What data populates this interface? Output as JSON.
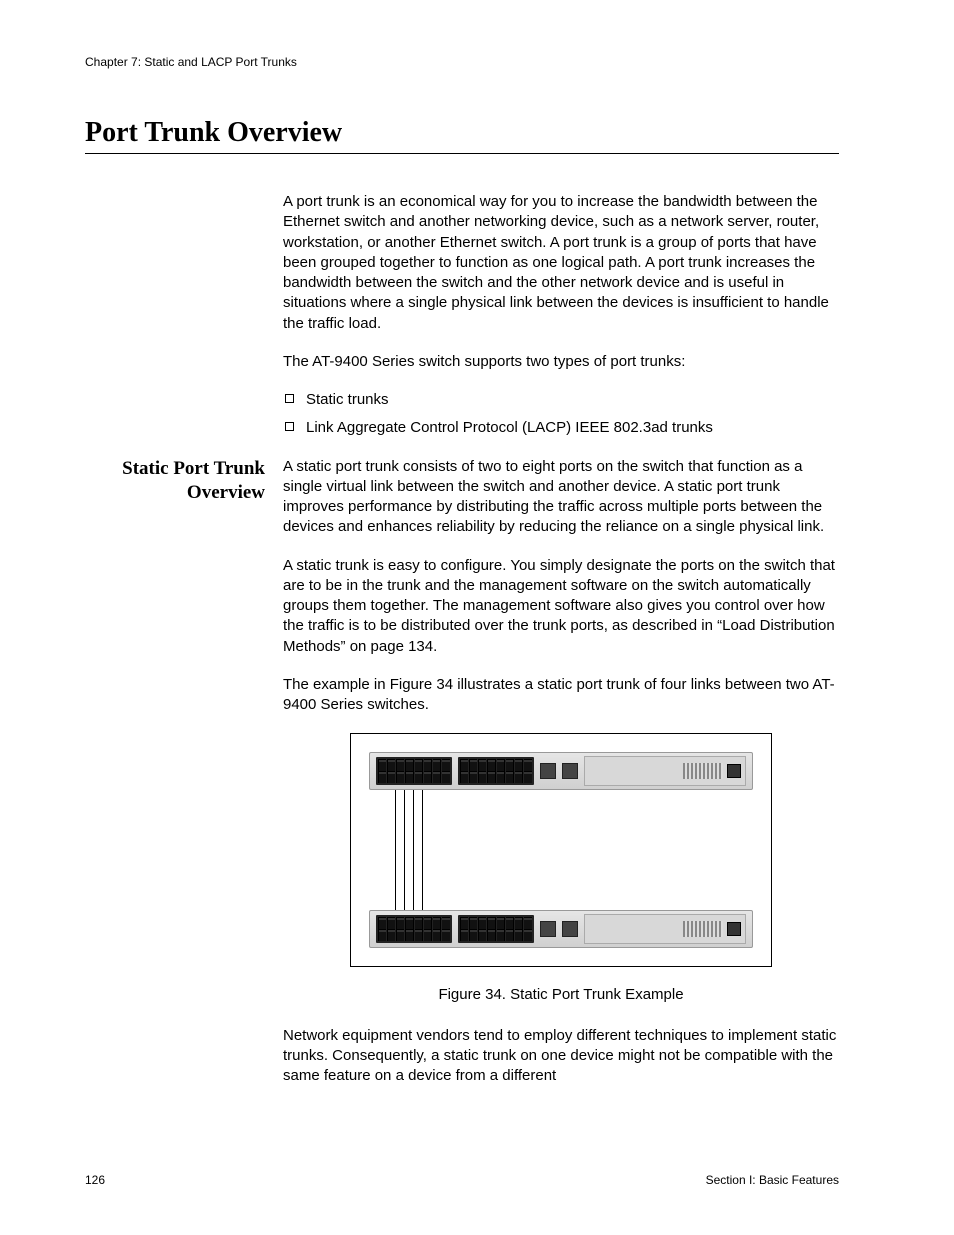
{
  "header": {
    "chapter": "Chapter 7: Static and LACP Port Trunks"
  },
  "heading": "Port Trunk Overview",
  "intro": {
    "p1": "A port trunk is an economical way for you to increase the bandwidth between the Ethernet switch and another networking device, such as a network server, router, workstation, or another Ethernet switch. A port trunk is a group of ports that have been grouped together to function as one logical path. A port trunk increases the bandwidth between the switch and the other network device and is useful in situations where a single physical link between the devices is insufficient to handle the traffic load.",
    "p2": "The AT-9400 Series switch supports two types of port trunks:",
    "bullets": [
      "Static trunks",
      "Link Aggregate Control Protocol (LACP) IEEE 802.3ad trunks"
    ]
  },
  "section": {
    "side_heading_l1": "Static Port Trunk",
    "side_heading_l2": "Overview",
    "p1": "A static port trunk consists of two to eight ports on the switch that function as a single virtual link between the switch and another device. A static port trunk improves performance by distributing the traffic across multiple ports between the devices and enhances reliability by reducing the reliance on a single physical link.",
    "p2": "A static trunk is easy to configure. You simply designate the ports on the switch that are to be in the trunk and the management software on the switch automatically groups them together. The management software also gives you control over how the traffic is to be distributed over the trunk ports, as described in “Load Distribution Methods” on page 134.",
    "p3": "The example in Figure 34 illustrates a static port trunk of four links between two AT-9400 Series switches.",
    "caption": "Figure 34. Static Port Trunk Example",
    "p4": "Network equipment vendors tend to employ different techniques to implement static trunks. Consequently, a static trunk on one device might not be compatible with the same feature on a device from a different"
  },
  "footer": {
    "page": "126",
    "section": "Section I: Basic Features"
  }
}
